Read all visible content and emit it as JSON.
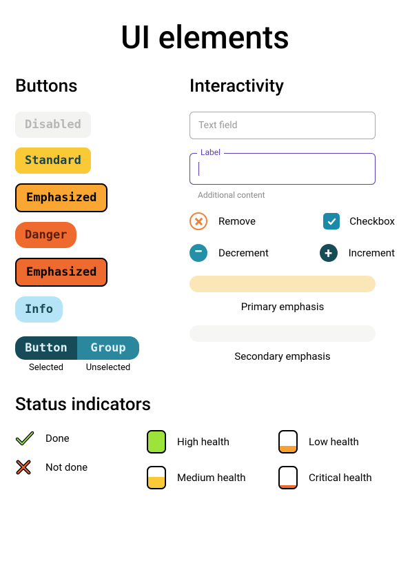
{
  "title": "UI elements",
  "sections": {
    "buttons": {
      "heading": "Buttons",
      "disabled": "Disabled",
      "standard": "Standard",
      "emphasized": "Emphasized",
      "danger": "Danger",
      "danger_emphasized": "Emphasized",
      "info": "Info",
      "group": {
        "a": "Button",
        "b": "Group",
        "a_sub": "Selected",
        "b_sub": "Unselected"
      }
    },
    "interactivity": {
      "heading": "Interactivity",
      "textfield_placeholder": "Text field",
      "labeled": {
        "label": "Label",
        "helper": "Additional content"
      },
      "remove": "Remove",
      "checkbox": "Checkbox",
      "decrement": "Decrement",
      "increment": "Increment",
      "primary_emphasis": "Primary emphasis",
      "secondary_emphasis": "Secondary emphasis"
    },
    "status": {
      "heading": "Status indicators",
      "done": "Done",
      "not_done": "Not done",
      "high": "High health",
      "medium": "Medium health",
      "low": "Low health",
      "critical": "Critical health"
    }
  }
}
